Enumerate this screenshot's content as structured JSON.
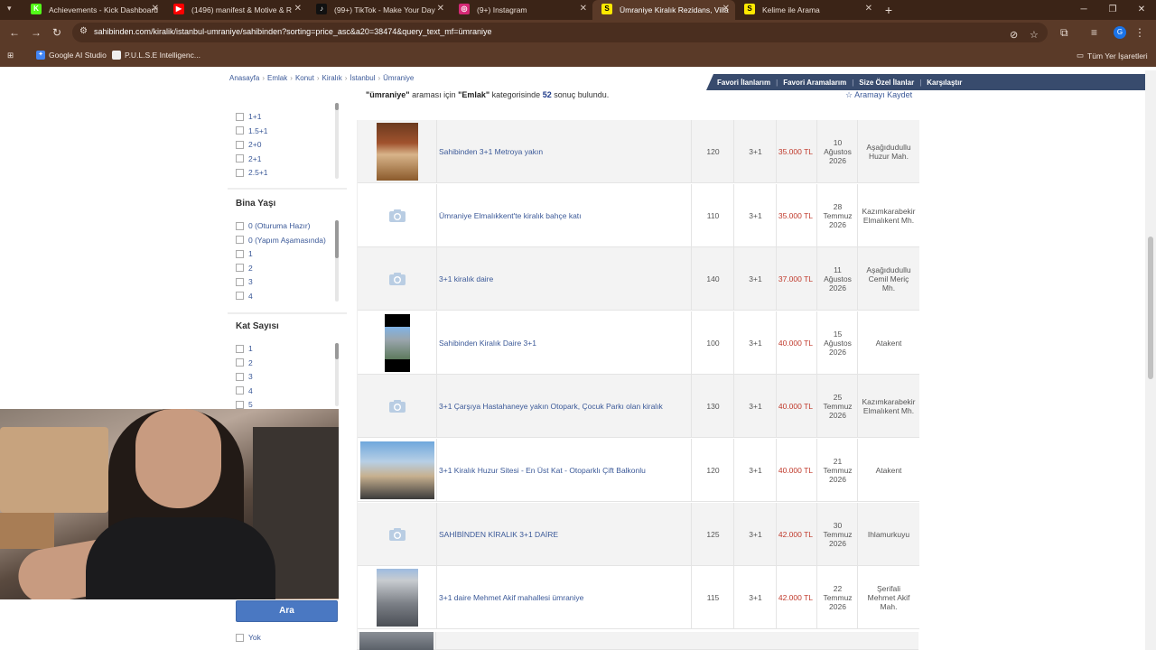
{
  "browser": {
    "tabs": [
      {
        "title": "Achievements - Kick Dashboard",
        "fav": "K",
        "fav_color": "#53fc18"
      },
      {
        "title": "(1496) manifest & Motive & R",
        "fav": "▶",
        "fav_color": "#ff0000"
      },
      {
        "title": "(99+) TikTok - Make Your Day",
        "fav": "♪",
        "fav_color": "#111111"
      },
      {
        "title": "(9+) Instagram",
        "fav": "◎",
        "fav_color": "#d62976"
      },
      {
        "title": "Ümraniye Kiralık Rezidans, Villa",
        "fav": "S",
        "fav_color": "#ffe800"
      },
      {
        "title": "Kelime ile Arama",
        "fav": "S",
        "fav_color": "#ffe800"
      }
    ],
    "url": "sahibinden.com/kiralik/istanbul-umraniye/sahibinden?sorting=price_asc&a20=38474&query_text_mf=ümraniye",
    "profile_initial": "G",
    "bookmarks": [
      {
        "label": "Google AI Studio"
      },
      {
        "label": "P.U.L.S.E Intelligenc..."
      }
    ],
    "bookmarks_right": "Tüm Yer İşaretleri"
  },
  "page": {
    "breadcrumbs": [
      "Anasayfa",
      "Emlak",
      "Konut",
      "Kiralık",
      "İstanbul",
      "Ümraniye"
    ],
    "top_links": [
      "Favori İlanlarım",
      "Favori Aramalarım",
      "Size Özel İlanlar",
      "Karşılaştır"
    ],
    "result": {
      "query": "\"ümraniye\"",
      "mid": " araması için ",
      "category": "\"Emlak\"",
      "mid2": " kategorisinde ",
      "count": "52",
      "end": " sonuç bulundu."
    },
    "save_search": "Aramayı Kaydet",
    "filters": {
      "rooms_partial": "",
      "rooms": [
        "1+1",
        "1.5+1",
        "2+0",
        "2+1",
        "2.5+1"
      ],
      "building_age_title": "Bina Yaşı",
      "building_age": [
        "0 (Oturuma Hazır)",
        "0 (Yapım Aşamasında)",
        "1",
        "2",
        "3",
        "4"
      ],
      "floor_count_title": "Kat Sayısı",
      "floor_count": [
        "1",
        "2",
        "3",
        "4",
        "5"
      ],
      "search_button": "Ara",
      "last_option": "Yok"
    },
    "listings": [
      {
        "image": "photo-interior",
        "title": "Sahibinden 3+1 Metroya yakın",
        "m2": "120",
        "rooms": "3+1",
        "price": "35.000 TL",
        "date": "10\nAğustos\n2026",
        "location": "Aşağıdudullu\nHuzur Mah."
      },
      {
        "image": "no-photo",
        "title": "Ümraniye Elmalıkkent'te kiralık bahçe katı",
        "m2": "110",
        "rooms": "3+1",
        "price": "35.000 TL",
        "date": "28\nTemmuz\n2026",
        "location": "Kazımkarabekir\nElmalıkent Mh."
      },
      {
        "image": "no-photo",
        "title": "3+1 kiralık daire",
        "m2": "140",
        "rooms": "3+1",
        "price": "37.000 TL",
        "date": "11\nAğustos\n2026",
        "location": "Aşağıdudullu\nCemil Meriç\nMh."
      },
      {
        "image": "photo-building-tall",
        "title": "Sahibinden Kiralık Daire 3+1",
        "m2": "100",
        "rooms": "3+1",
        "price": "40.000 TL",
        "date": "15\nAğustos\n2026",
        "location": "Atakent"
      },
      {
        "image": "no-photo",
        "title": "3+1 Çarşıya Hastahaneye yakın Otopark, Çocuk Parkı olan kiralık",
        "m2": "130",
        "rooms": "3+1",
        "price": "40.000 TL",
        "date": "25\nTemmuz\n2026",
        "location": "Kazımkarabekir\nElmalıkent Mh."
      },
      {
        "image": "photo-balcony",
        "title": "3+1 Kiralık Huzur Sitesi - En Üst Kat - Otoparklı Çift Balkonlu",
        "m2": "120",
        "rooms": "3+1",
        "price": "40.000 TL",
        "date": "21\nTemmuz\n2026",
        "location": "Atakent"
      },
      {
        "image": "no-photo",
        "title": "SAHİBİNDEN KİRALIK 3+1 DAİRE",
        "m2": "125",
        "rooms": "3+1",
        "price": "42.000 TL",
        "date": "30\nTemmuz\n2026",
        "location": "Ihlamurkuyu"
      },
      {
        "image": "photo-building",
        "title": "3+1 daire Mehmet Akif mahallesi ümraniye",
        "m2": "115",
        "rooms": "3+1",
        "price": "42.000 TL",
        "date": "22\nTemmuz\n2026",
        "location": "Şerifali\nMehmet Akif\nMah."
      }
    ]
  },
  "colors": {
    "price": "#c0392b",
    "link": "#3b5998",
    "chrome": "#5a3a28"
  }
}
